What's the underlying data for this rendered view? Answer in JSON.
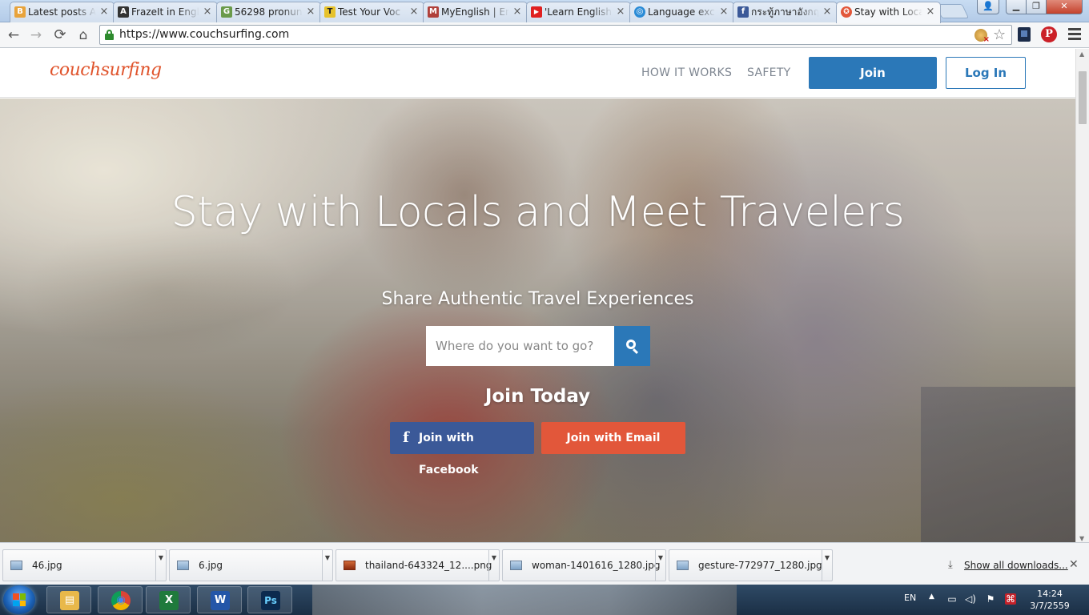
{
  "browser": {
    "tabs": [
      {
        "title": "Latest posts A",
        "favicon_color": "#e8a33b",
        "favicon_glyph": "B"
      },
      {
        "title": "FrazeIt in Engl",
        "favicon_color": "#333333",
        "favicon_glyph": "A"
      },
      {
        "title": "56298 pronun",
        "favicon_color": "#6a9a4a",
        "favicon_glyph": "G"
      },
      {
        "title": "Test Your Voc",
        "favicon_color": "#e6c22c",
        "favicon_glyph": "T"
      },
      {
        "title": "MyEnglish | En",
        "favicon_color": "#b0403a",
        "favicon_glyph": "M"
      },
      {
        "title": "'Learn English",
        "favicon_color": "#e02020",
        "favicon_glyph": "▶"
      },
      {
        "title": "Language exc",
        "favicon_color": "#2a8bd6",
        "favicon_glyph": "◎"
      },
      {
        "title": "กระทู้ภาษาอังกฤ",
        "favicon_color": "#3b5998",
        "favicon_glyph": "f"
      },
      {
        "title": "Stay with Loca",
        "favicon_color": "#e2573a",
        "favicon_glyph": "✪"
      }
    ],
    "close_glyph": "×",
    "url": "https://www.couchsurfing.com",
    "window": {
      "minimize": "▁",
      "maximize": "❐",
      "close": "✕",
      "user": "👤"
    },
    "nav": {
      "back": "←",
      "forward": "→",
      "reload": "⟳",
      "home": "⌂"
    },
    "star": "☆",
    "pinterest": "P",
    "icons": {
      "lock": "lock-icon",
      "star": "star-icon",
      "menu": "menu-icon",
      "pinterest": "pinterest-icon"
    }
  },
  "site": {
    "logo": "couchsurfing",
    "nav": {
      "how_it_works": "HOW IT WORKS",
      "safety": "SAFETY"
    },
    "join_label": "Join",
    "login_label": "Log In",
    "hero": {
      "title": "Stay with Locals and Meet Travelers",
      "subtitle": "Share Authentic Travel Experiences",
      "search_placeholder": "Where do you want to go?",
      "join_today": "Join Today",
      "facebook_label": "Join with Facebook",
      "facebook_glyph": "f",
      "email_label": "Join with Email"
    },
    "colors": {
      "brand_blue": "#2b78b8",
      "brand_orange": "#e2573a",
      "facebook": "#3b5998"
    }
  },
  "downloads": {
    "items": [
      {
        "name": "46.jpg",
        "type": "image"
      },
      {
        "name": "6.jpg",
        "type": "image"
      },
      {
        "name": "thailand-643324_12....png",
        "type": "psd"
      },
      {
        "name": "woman-1401616_1280.jpg",
        "type": "image"
      },
      {
        "name": "gesture-772977_1280.jpg",
        "type": "image"
      }
    ],
    "arrow_glyph": "▼",
    "show_all": "Show all downloads...",
    "download_glyph": "⤓",
    "close_glyph": "✕"
  },
  "taskbar": {
    "apps": [
      {
        "name": "explorer",
        "glyph": "▤",
        "color": "#e8b84a"
      },
      {
        "name": "chrome",
        "glyph": "◉",
        "color": "#3a8a3a"
      },
      {
        "name": "excel",
        "glyph": "X",
        "color": "#1f7a3c"
      },
      {
        "name": "word",
        "glyph": "W",
        "color": "#2456a8"
      },
      {
        "name": "photoshop",
        "glyph": "Ps",
        "color": "#0c2a4e"
      }
    ],
    "lang": "EN",
    "tray_up": "▲",
    "tray_icons": [
      "▭",
      "◁)",
      "⚑",
      "⌘"
    ],
    "time": "14:24",
    "date": "3/7/2559"
  }
}
